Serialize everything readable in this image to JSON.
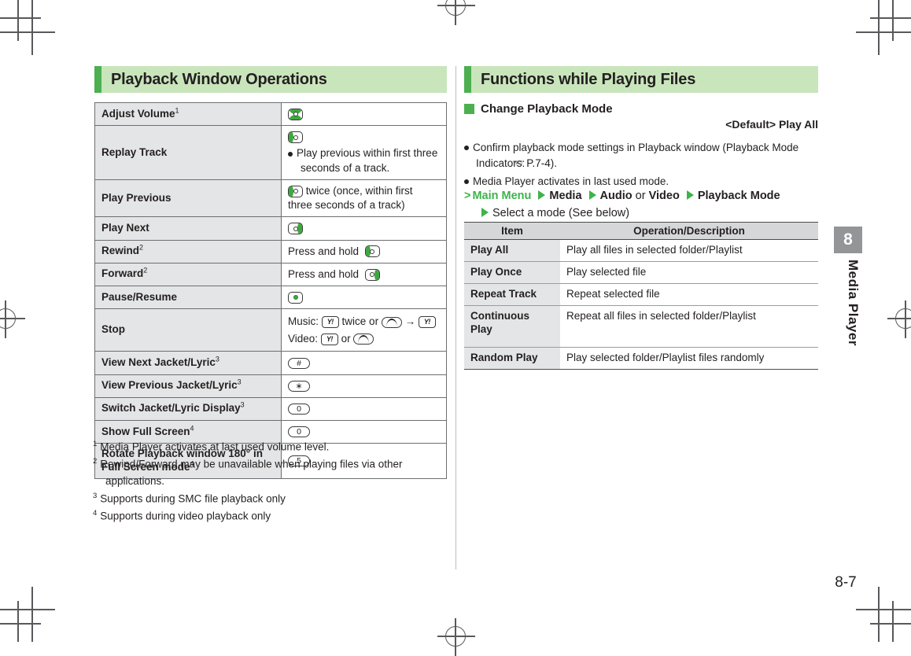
{
  "page": {
    "number": "8-7",
    "chapter_number": "8",
    "chapter_name": "Media Player"
  },
  "left_section": {
    "heading": "Playback Window Operations",
    "table": {
      "rows": [
        {
          "label": "Adjust Volume",
          "footnote": "1",
          "value_text": "",
          "icon": "nav-key-up-down"
        },
        {
          "label": "Replay Track",
          "footnote": "",
          "value_text": "Play previous within first three seconds of a track.",
          "icon": "nav-key-left"
        },
        {
          "label": "Play Previous",
          "footnote": "",
          "value_text": "twice (once, within first three seconds of a track)",
          "icon": "nav-key-left"
        },
        {
          "label": "Play Next",
          "footnote": "",
          "value_text": "",
          "icon": "nav-key-right"
        },
        {
          "label": "Rewind",
          "footnote": "2",
          "value_text": "Press and hold",
          "icon": "nav-key-left"
        },
        {
          "label": "Forward",
          "footnote": "2",
          "value_text": "Press and hold",
          "icon": "nav-key-right"
        },
        {
          "label": "Pause/Resume",
          "footnote": "",
          "value_text": "",
          "icon": "nav-key-center"
        },
        {
          "label": "Stop",
          "footnote": "",
          "value_text": "",
          "icon": "stop-sequence",
          "music_prefix": "Music:",
          "music_mid": "twice or",
          "music_arrow": "→",
          "video_prefix": "Video:",
          "video_mid": "or"
        },
        {
          "label": "View Next Jacket/Lyric",
          "footnote": "3",
          "value_text": "",
          "icon": "num-key",
          "key_label": "#"
        },
        {
          "label": "View Previous Jacket/Lyric",
          "footnote": "3",
          "value_text": "",
          "icon": "num-key",
          "key_label": "∗"
        },
        {
          "label": "Switch Jacket/Lyric Display",
          "footnote": "3",
          "value_text": "",
          "icon": "num-key",
          "key_label": "0"
        },
        {
          "label": "Show Full Screen",
          "footnote": "4",
          "value_text": "",
          "icon": "num-key",
          "key_label": "0"
        },
        {
          "label": "Rotate Playback window 180° in Full Screen mode",
          "footnote": "4",
          "value_text": "",
          "icon": "num-key",
          "key_label": "5"
        }
      ]
    },
    "footnotes": [
      {
        "num": "1",
        "text": "Media Player activates at last used volume level."
      },
      {
        "num": "2",
        "text": "Rewind/Forward may be unavailable when playing files via other applications."
      },
      {
        "num": "3",
        "text": "Supports during SMC file playback only"
      },
      {
        "num": "4",
        "text": "Supports during video playback only"
      }
    ]
  },
  "right_section": {
    "heading": "Functions while Playing Files",
    "subheading": "Change Playback Mode",
    "default_label": "<Default> Play All",
    "notes": [
      {
        "text": "Confirm playback mode settings in Playback window (Playback Mode Indicators:",
        "reference": "P.7-4).",
        "has_hand_icon": true
      },
      {
        "text": "Media Player activates in last used mode.",
        "reference": "",
        "has_hand_icon": false
      }
    ],
    "menu_path": {
      "start": "Main Menu",
      "steps": [
        "Media",
        "Audio",
        "Video",
        "Playback Mode"
      ],
      "or_word": "or",
      "final_step": "Select a mode (See below)"
    },
    "table": {
      "headers": [
        "Item",
        "Operation/Description"
      ],
      "rows": [
        {
          "item": "Play All",
          "description": "Play all files in selected folder/Playlist"
        },
        {
          "item": "Play Once",
          "description": "Play selected file"
        },
        {
          "item": "Repeat Track",
          "description": "Repeat selected file"
        },
        {
          "item": "Continuous Play",
          "description": "Repeat all files in selected folder/Playlist"
        },
        {
          "item": "Random Play",
          "description": "Play selected folder/Playlist files randomly"
        }
      ]
    }
  },
  "colors": {
    "accent_green": "#4caf50",
    "heading_bg": "#c9e5bc",
    "link_green": "#3cb44a",
    "row_gray": "#e4e5e6",
    "header_gray": "#d6d7d8",
    "tab_gray": "#939598"
  }
}
